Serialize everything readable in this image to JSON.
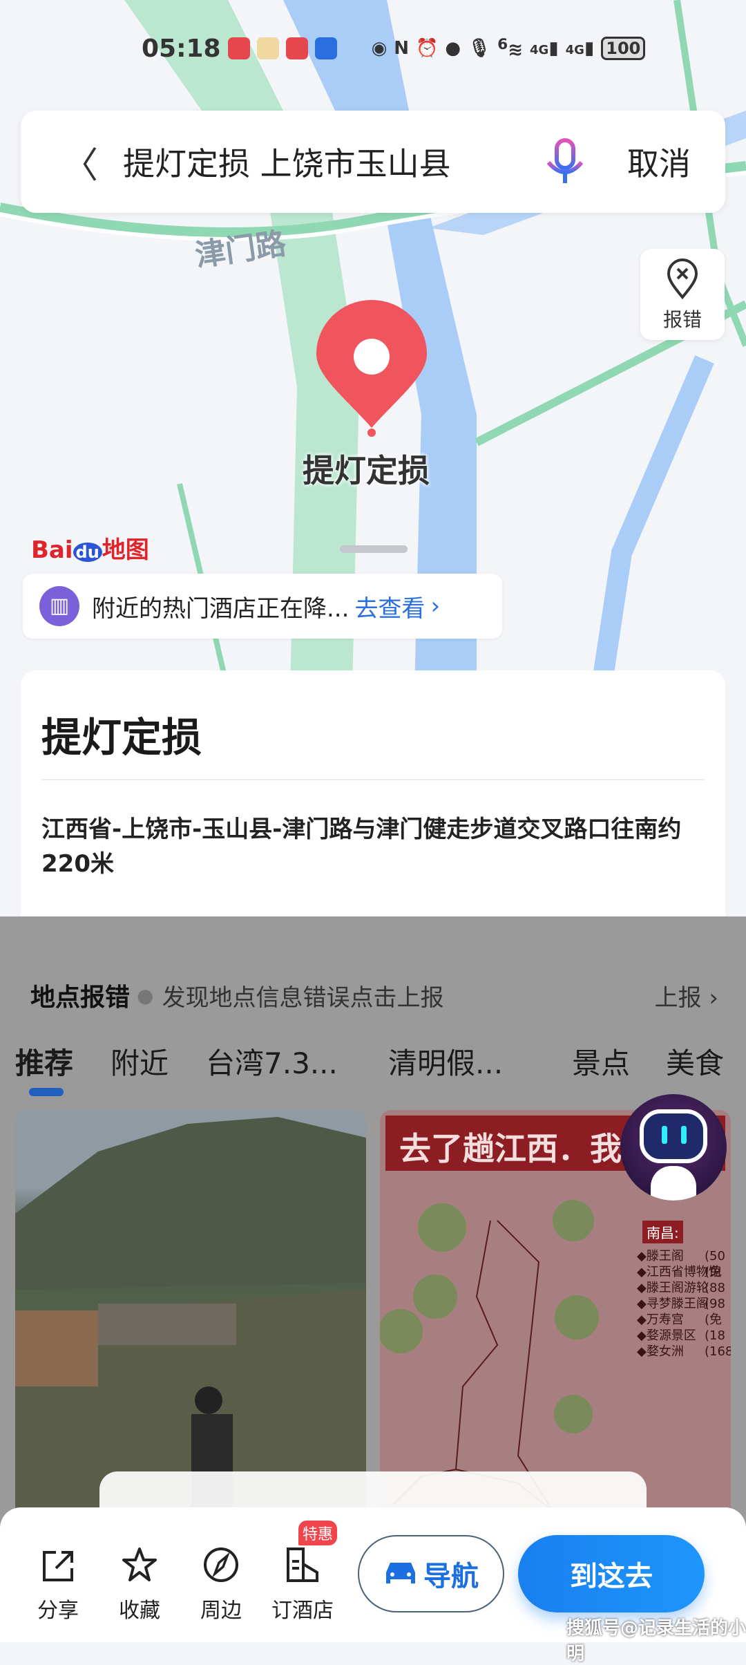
{
  "status_bar": {
    "time": "05:18",
    "signal1": "4G",
    "signal2": "4G",
    "wifi": "6",
    "battery": "100"
  },
  "search": {
    "query": "提灯定损 上饶市玉山县",
    "cancel_label": "取消"
  },
  "map": {
    "road_label": "津门路",
    "report_error_label": "报错",
    "pin_label": "提灯定损",
    "logo_text": "Baidu地图"
  },
  "hotel_banner": {
    "text": "附近的热门酒店正在降...",
    "link": "去查看"
  },
  "place": {
    "title": "提灯定损",
    "address": "江西省-上饶市-玉山县-津门路与津门健走步道交叉路口往南约220米"
  },
  "report": {
    "heading": "地点报错",
    "subtext": "发现地点信息错误点击上报",
    "action": "上报"
  },
  "tabs": [
    {
      "label": "推荐",
      "active": true
    },
    {
      "label": "附近"
    },
    {
      "label": "台湾7.3..."
    },
    {
      "label": "清明假..."
    },
    {
      "label": "景点"
    },
    {
      "label": "美食"
    }
  ],
  "feed": {
    "card2_title": "去了趟江西．我",
    "card2_section": "南昌:",
    "card2_list": [
      "◆滕王阁",
      "◆江西省博物馆",
      "◆滕王阁游轮",
      "◆寻梦滕王阁",
      "◆万寿宫",
      "◆婺源景区",
      "◆婺女洲"
    ],
    "card2_prices": [
      "(50",
      "(免",
      "(88",
      "(98",
      "(免",
      "(18",
      "(168"
    ]
  },
  "bottom_bar": {
    "actions": [
      {
        "label": "分享",
        "icon": "share-icon"
      },
      {
        "label": "收藏",
        "icon": "star-icon"
      },
      {
        "label": "周边",
        "icon": "compass-icon"
      },
      {
        "label": "订酒店",
        "icon": "hotel-icon",
        "badge": "特惠"
      }
    ],
    "navigate_label": "导航",
    "go_label": "到这去"
  },
  "watermark": "搜狐号@记录生活的小明",
  "colors": {
    "accent": "#1a7ff0",
    "pin": "#f0545c",
    "map_road": "#9fe0c0",
    "map_river": "#a9cdf7"
  }
}
